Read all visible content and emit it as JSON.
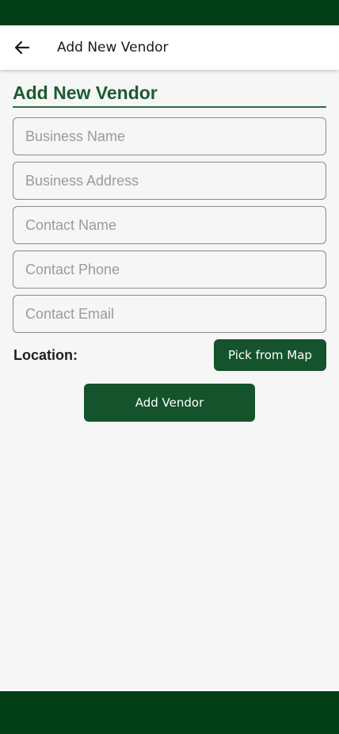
{
  "app_bar": {
    "title": "Add New Vendor"
  },
  "form": {
    "heading": "Add New Vendor",
    "fields": [
      {
        "placeholder": "Business Name",
        "value": ""
      },
      {
        "placeholder": "Business Address",
        "value": ""
      },
      {
        "placeholder": "Contact Name",
        "value": ""
      },
      {
        "placeholder": "Contact Phone",
        "value": ""
      },
      {
        "placeholder": "Contact Email",
        "value": ""
      }
    ],
    "location_label": "Location:",
    "pick_from_map_label": "Pick from Map",
    "submit_label": "Add Vendor"
  },
  "icons": {
    "back": "arrow-left-icon"
  },
  "colors": {
    "status_bar": "#033f16",
    "accent": "#1a5c2e",
    "button": "#14532b",
    "background": "#f6f6f6"
  }
}
